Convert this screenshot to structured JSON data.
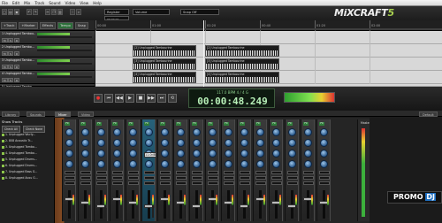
{
  "menu": [
    "File",
    "Edit",
    "Mix",
    "Track",
    "Sound",
    "Video",
    "View",
    "Help"
  ],
  "toolbar": {
    "select1": "Register",
    "select2": "Volume",
    "select3": "Snap Off",
    "clip_label": "00:04:01",
    "logo_main": "MiXCRAFT",
    "logo_accent": "5"
  },
  "track_toolbar": {
    "add_track": "+Track",
    "markers": "+Marker",
    "effects": "Effects",
    "tempo": "Tempo",
    "snap": "Snap"
  },
  "ruler": {
    "ticks": [
      "00:00",
      "01:00",
      "01:20",
      "00:40",
      "01:20",
      "02:00"
    ]
  },
  "tracks": [
    {
      "name": "1 Unplugged Tambou...",
      "clips": []
    },
    {
      "name": "2 Unplugged Tambo...",
      "clips": [
        {
          "name": "[2] Unplugged Tambourine"
        },
        {
          "name": "[2] Unplugged Tambourine"
        }
      ]
    },
    {
      "name": "3 Unplugged Tambo...",
      "clips": [
        {
          "name": "[3] Unplugged Tambourine"
        },
        {
          "name": "[3] Unplugged Tambourine"
        }
      ]
    },
    {
      "name": "4 Unplugged Tambo...",
      "clips": [
        {
          "name": "[4] Unplugged Tambourine"
        },
        {
          "name": "[4] Unplugged Tambourine"
        }
      ]
    },
    {
      "name": "5 Unplugged Tambo...",
      "clips": []
    }
  ],
  "transport": {
    "bpm": "117.0 BPM   4 / 4   G",
    "clock": "00:00:48.249",
    "buttons": [
      "record",
      "rewind",
      "back",
      "play",
      "stop",
      "forward",
      "end",
      "loop"
    ]
  },
  "lower_tabs": [
    "Library",
    "Sounds",
    "Mixer",
    "Video"
  ],
  "lower_active_tab": "Mixer",
  "right_tab": "Default",
  "side": {
    "header": "Show Tracks",
    "check_all": "Check All",
    "check_none": "Check None",
    "items": [
      "1. Unplugged Wurly...",
      "2. 808 Acoustic Tr...",
      "3. Unplugged Tambo...",
      "4. Unplugged Tambo...",
      "5. Unplugged Drums...",
      "6. Unplugged Drums...",
      "7. Unplugged Bass G...",
      "8. Unplugged Acou G..."
    ]
  },
  "mixer": {
    "strip_count": 17,
    "selected_strip": 5,
    "fx_label": "FX",
    "master_label": "Master",
    "tooltip": "11.0dB"
  },
  "watermark": {
    "promo": "PROMO",
    "dj": "DJ"
  },
  "colors": {
    "accent": "#a8d050",
    "clock": "#b8f0b8",
    "selected_strip": "#27617a"
  }
}
